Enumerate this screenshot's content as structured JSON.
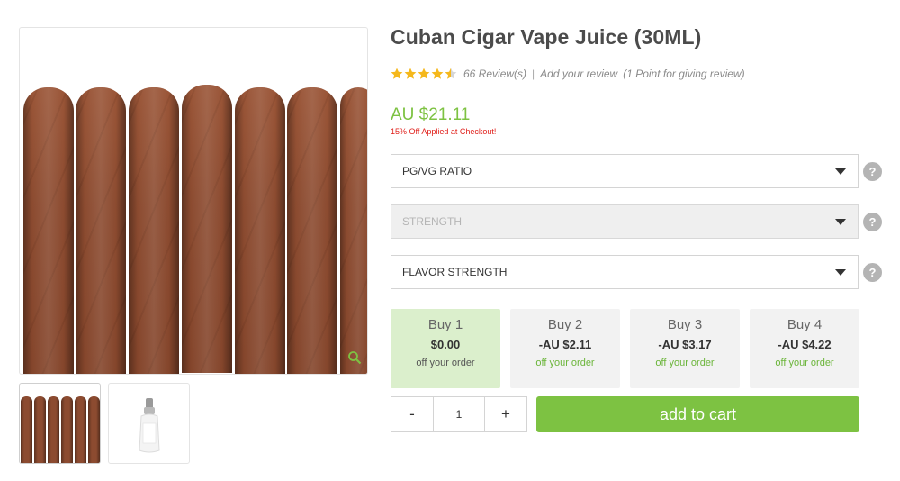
{
  "product": {
    "title": "Cuban Cigar Vape Juice (30ML)",
    "rating": 4.5,
    "rating_max": 5,
    "reviews_text": "66 Review(s)",
    "separator": "|",
    "add_review": "Add your review",
    "review_points": "(1 Point for giving review)",
    "price": "AU $21.11",
    "promo": "15% Off Applied at Checkout!"
  },
  "gallery": {
    "main_image": "cigars-photo",
    "thumbnails": [
      "cigars-thumbnail",
      "bottle-thumbnail"
    ]
  },
  "options": [
    {
      "label": "PG/VG RATIO",
      "disabled": false,
      "help": "?"
    },
    {
      "label": "STRENGTH",
      "disabled": true,
      "help": "?"
    },
    {
      "label": "FLAVOR STRENGTH",
      "disabled": false,
      "help": "?"
    }
  ],
  "tiers": [
    {
      "label": "Buy 1",
      "amount": "$0.00",
      "note": "off your order",
      "selected": true
    },
    {
      "label": "Buy 2",
      "amount": "-AU $2.11",
      "note": "off your order",
      "selected": false
    },
    {
      "label": "Buy 3",
      "amount": "-AU $3.17",
      "note": "off your order",
      "selected": false
    },
    {
      "label": "Buy 4",
      "amount": "-AU $4.22",
      "note": "off your order",
      "selected": false
    }
  ],
  "quantity": {
    "minus": "-",
    "value": "1",
    "plus": "+"
  },
  "cart": {
    "label": "add to cart"
  },
  "colors": {
    "accent": "#7dc242",
    "promo": "#e0201b",
    "star": "#f5b81c",
    "tier_selected": "#dbefcc"
  }
}
